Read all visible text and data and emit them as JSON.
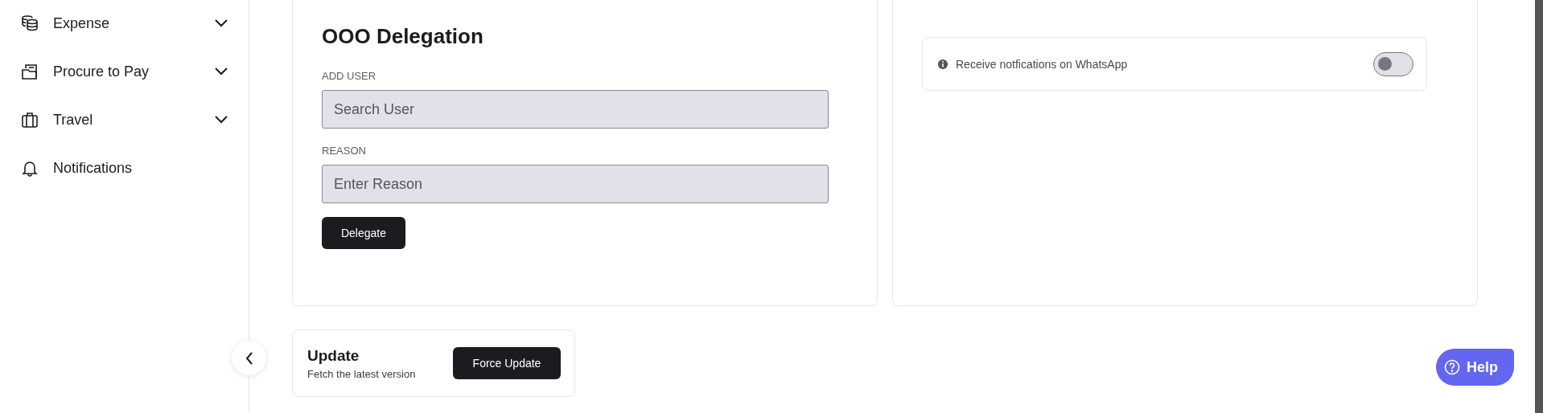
{
  "sidebar": {
    "items": [
      {
        "label": "Expense",
        "expanded": false
      },
      {
        "label": "Procure to Pay",
        "expanded": false
      },
      {
        "label": "Travel",
        "expanded": false
      },
      {
        "label": "Notifications"
      }
    ]
  },
  "delegation": {
    "title": "OOO Delegation",
    "fields": [
      {
        "label": "ADD USER",
        "placeholder": "Search User"
      },
      {
        "label": "REASON",
        "placeholder": "Enter Reason"
      }
    ],
    "button": "Delegate"
  },
  "whatsapp": {
    "label": "Receive notfications on WhatsApp",
    "on": false
  },
  "update": {
    "title": "Update",
    "subtitle": "Fetch the latest version",
    "button": "Force Update"
  },
  "help": {
    "label": "Help"
  }
}
